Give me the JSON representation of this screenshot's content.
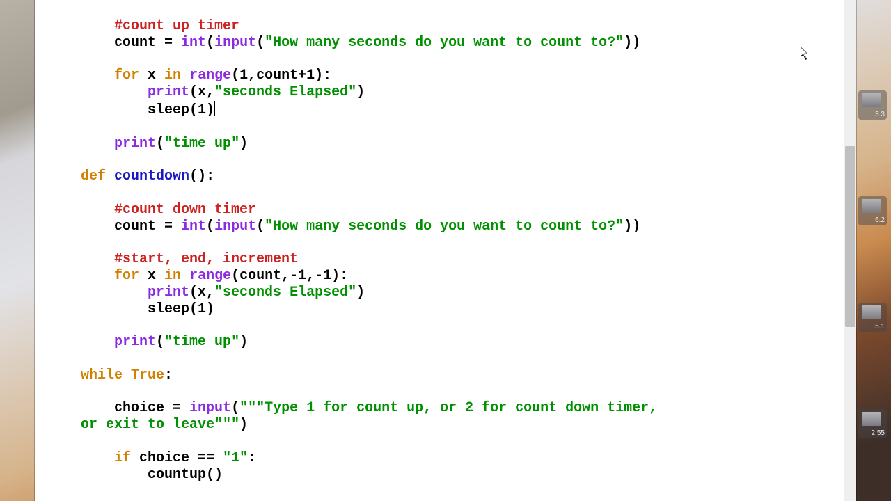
{
  "code": {
    "l01_comment": "#count up timer",
    "l02_a": "count = ",
    "l02_b": "int",
    "l02_c": "(",
    "l02_d": "input",
    "l02_e": "(",
    "l02_f": "\"How many seconds do you want to count to?\"",
    "l02_g": "))",
    "l03_a": "for",
    "l03_b": " x ",
    "l03_c": "in",
    "l03_d": " ",
    "l03_e": "range",
    "l03_f": "(1,count+1):",
    "l04_a": "print",
    "l04_b": "(x,",
    "l04_c": "\"seconds Elapsed\"",
    "l04_d": ")",
    "l05_a": "sleep(1)",
    "l06_a": "print",
    "l06_b": "(",
    "l06_c": "\"time up\"",
    "l06_d": ")",
    "l07_a": "def",
    "l07_b": " ",
    "l07_c": "countdown",
    "l07_d": "():",
    "l08_comment": "#count down timer",
    "l09_a": "count = ",
    "l09_b": "int",
    "l09_c": "(",
    "l09_d": "input",
    "l09_e": "(",
    "l09_f": "\"How many seconds do you want to count to?\"",
    "l09_g": "))",
    "l10_comment": "#start, end, increment",
    "l11_a": "for",
    "l11_b": " x ",
    "l11_c": "in",
    "l11_d": " ",
    "l11_e": "range",
    "l11_f": "(count,-1,-1):",
    "l12_a": "print",
    "l12_b": "(x,",
    "l12_c": "\"seconds Elapsed\"",
    "l12_d": ")",
    "l13_a": "sleep(1)",
    "l14_a": "print",
    "l14_b": "(",
    "l14_c": "\"time up\"",
    "l14_d": ")",
    "l15_a": "while",
    "l15_b": " ",
    "l15_c": "True",
    "l15_d": ":",
    "l16_a": "choice = ",
    "l16_b": "input",
    "l16_c": "(",
    "l16_d": "\"\"\"Type 1 for count up, or 2 for count down timer,",
    "l16_e": "or exit to leave\"\"\"",
    "l16_f": ")",
    "l17_a": "if",
    "l17_b": " choice == ",
    "l17_c": "\"1\"",
    "l17_d": ":",
    "l18_a": "countup()"
  },
  "desktop": {
    "snaps": [
      "3.3",
      "6.2",
      "5.1",
      "2.55"
    ]
  }
}
